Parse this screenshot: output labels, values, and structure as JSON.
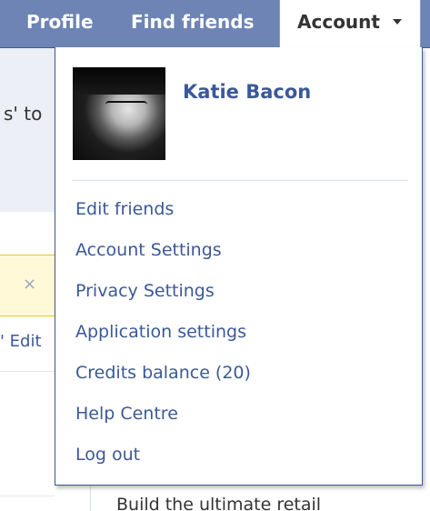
{
  "nav": {
    "profile": "Profile",
    "find_friends": "Find friends",
    "account": "Account"
  },
  "background": {
    "snippet_top": "s' to",
    "close_glyph": "×",
    "edit_snippet": "' Edit",
    "bottom_text": "Build the ultimate retail"
  },
  "dropdown": {
    "user_name": "Katie Bacon",
    "items": [
      "Edit friends",
      "Account Settings",
      "Privacy Settings",
      "Application settings",
      "Credits balance (20)",
      "Help Centre",
      "Log out"
    ]
  },
  "colors": {
    "bar": "#6d84b4",
    "link": "#3b5998"
  }
}
